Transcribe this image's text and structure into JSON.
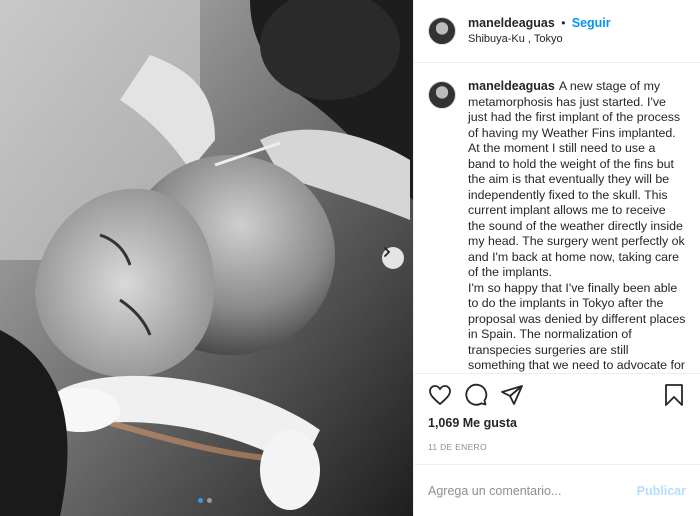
{
  "post": {
    "username": "maneldeaguas",
    "follow_label": "Seguir",
    "separator": "•",
    "location": "Shibuya-Ku , Tokyo"
  },
  "caption": {
    "username": "maneldeaguas",
    "text": "A new stage of my metamorphosis has just started. I've just had the first implant of the process of having my Weather Fins implanted. At the moment I still need to use a band to hold the weight of the fins but the aim is that eventually they will be independently fixed to the skull. This current implant allows me to receive the sound of the weather directly inside my head. The surgery went perfectly ok and I'm back at home now, taking care of the implants.",
    "text2": "I'm so happy that I've finally been able to do the implants in Tokyo after the proposal was denied by different places in Spain. The normalization of transpecies surgeries are still something that we need to advocate for and it's still difficult to find"
  },
  "actions": {
    "likes": "1,069 Me gusta",
    "date": "11 DE ENERO",
    "icons": [
      "heart-icon",
      "comment-icon",
      "share-icon",
      "bookmark-icon"
    ]
  },
  "comment_box": {
    "placeholder": "Agrega un comentario...",
    "publish_label": "Publicar"
  },
  "carousel": {
    "icon": "chevron-right-icon",
    "current_index": 1,
    "total": 2
  }
}
